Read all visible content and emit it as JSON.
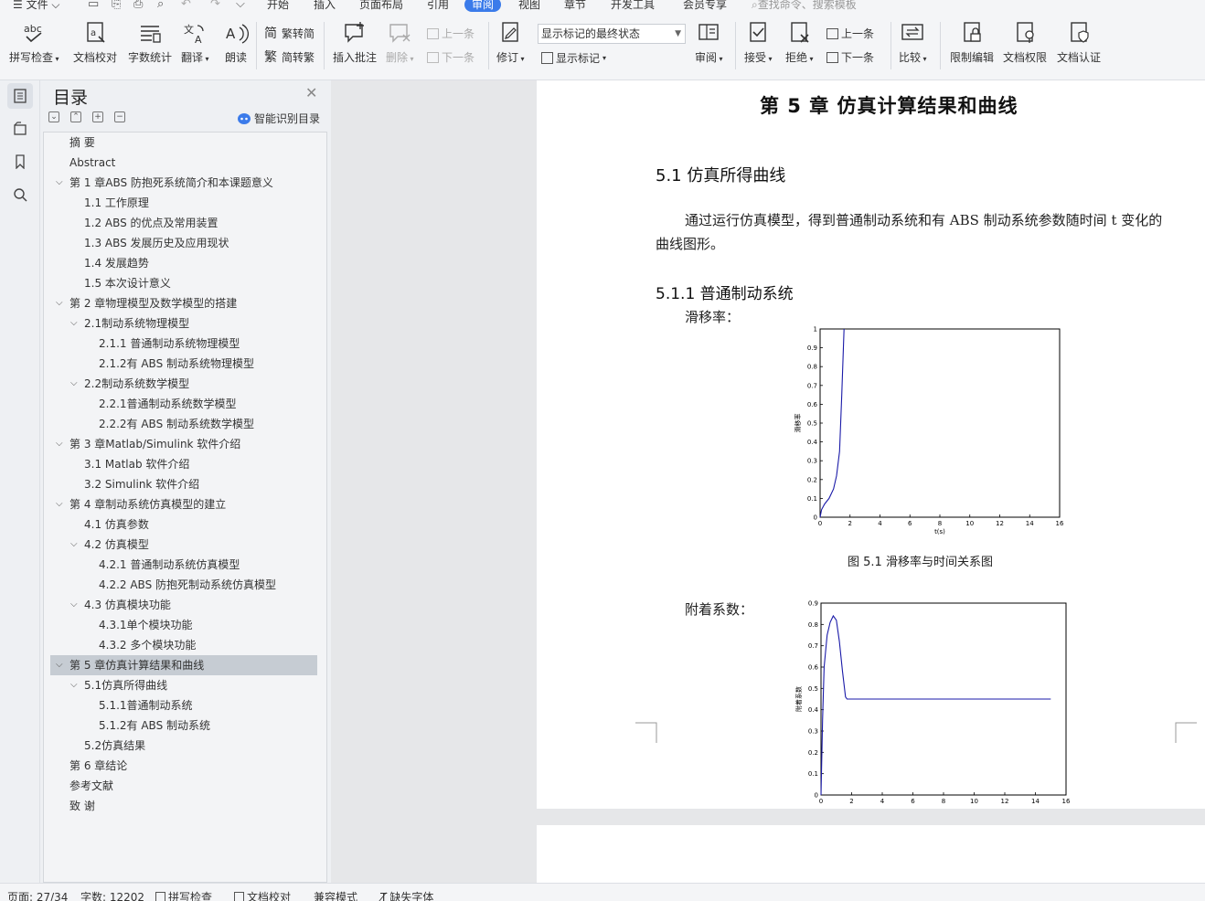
{
  "menubar": {
    "file": "文件",
    "tabs": [
      "开始",
      "插入",
      "页面布局",
      "引用",
      "审阅",
      "视图",
      "章节",
      "开发工具",
      "会员专享"
    ],
    "active_tab": "审阅",
    "search": "查找命令、搜索模板"
  },
  "ribbon": {
    "spell": "拼写检查",
    "proof": "文档校对",
    "wordcount": "字数统计",
    "translate": "翻译",
    "read": "朗读",
    "trad": "繁转简",
    "simp": "简转繁",
    "insert_comment": "插入批注",
    "delete": "删除",
    "prev": "上一条",
    "next": "下一条",
    "revise": "修订",
    "markup_state": "显示标记的最终状态",
    "show_markup": "显示标记",
    "review": "审阅",
    "accept": "接受",
    "reject": "拒绝",
    "prev2": "上一条",
    "next2": "下一条",
    "compare": "比较",
    "restrict": "限制编辑",
    "permission": "文档权限",
    "certify": "文档认证"
  },
  "toc": {
    "title": "目录",
    "smart": "智能识别目录",
    "items": [
      {
        "label": "摘  要",
        "level": 0,
        "chev": ""
      },
      {
        "label": "Abstract",
        "level": 0,
        "chev": ""
      },
      {
        "label": "第 1 章ABS 防抱死系统简介和本课题意义",
        "level": 0,
        "chev": "v"
      },
      {
        "label": "1.1  工作原理",
        "level": 1,
        "chev": ""
      },
      {
        "label": "1.2  ABS 的优点及常用装置",
        "level": 1,
        "chev": ""
      },
      {
        "label": "1.3  ABS 发展历史及应用现状",
        "level": 1,
        "chev": ""
      },
      {
        "label": "1.4  发展趋势",
        "level": 1,
        "chev": ""
      },
      {
        "label": "1.5  本次设计意义",
        "level": 1,
        "chev": ""
      },
      {
        "label": "第 2 章物理模型及数学模型的搭建",
        "level": 0,
        "chev": "v"
      },
      {
        "label": "2.1制动系统物理模型",
        "level": 1,
        "chev": "v"
      },
      {
        "label": "2.1.1  普通制动系统物理模型",
        "level": 2,
        "chev": ""
      },
      {
        "label": "2.1.2有 ABS 制动系统物理模型",
        "level": 2,
        "chev": ""
      },
      {
        "label": "2.2制动系统数学模型",
        "level": 1,
        "chev": "v"
      },
      {
        "label": "2.2.1普通制动系统数学模型",
        "level": 2,
        "chev": ""
      },
      {
        "label": "2.2.2有 ABS 制动系统数学模型",
        "level": 2,
        "chev": ""
      },
      {
        "label": "第 3 章Matlab/Simulink 软件介绍",
        "level": 0,
        "chev": "v"
      },
      {
        "label": "3.1  Matlab 软件介绍",
        "level": 1,
        "chev": ""
      },
      {
        "label": "3.2  Simulink 软件介绍",
        "level": 1,
        "chev": ""
      },
      {
        "label": "第 4 章制动系统仿真模型的建立",
        "level": 0,
        "chev": "v"
      },
      {
        "label": "4.1  仿真参数",
        "level": 1,
        "chev": ""
      },
      {
        "label": "4.2  仿真模型",
        "level": 1,
        "chev": "v"
      },
      {
        "label": "4.2.1  普通制动系统仿真模型",
        "level": 2,
        "chev": ""
      },
      {
        "label": "4.2.2  ABS 防抱死制动系统仿真模型",
        "level": 2,
        "chev": ""
      },
      {
        "label": "4.3  仿真模块功能",
        "level": 1,
        "chev": "v"
      },
      {
        "label": "4.3.1单个模块功能",
        "level": 2,
        "chev": ""
      },
      {
        "label": "4.3.2  多个模块功能",
        "level": 2,
        "chev": ""
      },
      {
        "label": "第 5 章仿真计算结果和曲线",
        "level": 0,
        "chev": "v",
        "active": true
      },
      {
        "label": "5.1仿真所得曲线",
        "level": 1,
        "chev": "v"
      },
      {
        "label": "5.1.1普通制动系统",
        "level": 2,
        "chev": ""
      },
      {
        "label": "5.1.2有 ABS 制动系统",
        "level": 2,
        "chev": ""
      },
      {
        "label": "5.2仿真结果",
        "level": 1,
        "chev": ""
      },
      {
        "label": "第 6 章结论",
        "level": 0,
        "chev": ""
      },
      {
        "label": "参考文献",
        "level": 0,
        "chev": ""
      },
      {
        "label": "致  谢",
        "level": 0,
        "chev": ""
      }
    ]
  },
  "doc": {
    "chapter_title": "第 5 章  仿真计算结果和曲线",
    "h2": "5.1  仿真所得曲线",
    "para": "通过运行仿真模型，得到普通制动系统和有 ABS 制动系统参数随时间 t 变化的曲线图形。",
    "h3": "5.1.1  普通制动系统",
    "label1": "滑移率：",
    "caption1": "图 5.1  滑移率与时间关系图",
    "label2": "附着系数："
  },
  "status": {
    "page": "页面: 27/34",
    "words": "字数: 12202",
    "spell": "拼写检查",
    "proof": "文档校对",
    "compat": "兼容模式",
    "missing_font": "缺失字体"
  },
  "chart_data": [
    {
      "type": "line",
      "title": "",
      "xlabel": "t(s)",
      "ylabel": "滑移率",
      "xlim": [
        0,
        16
      ],
      "ylim": [
        0,
        1
      ],
      "xticks": [
        0,
        2,
        4,
        6,
        8,
        10,
        12,
        14,
        16
      ],
      "yticks": [
        0,
        0.1,
        0.2,
        0.3,
        0.4,
        0.5,
        0.6,
        0.7,
        0.8,
        0.9,
        1
      ],
      "series": [
        {
          "x": [
            0,
            0.1,
            0.3,
            0.6,
            0.9,
            1.1,
            1.3,
            1.45,
            1.6
          ],
          "y": [
            0,
            0.04,
            0.07,
            0.1,
            0.15,
            0.22,
            0.35,
            0.65,
            1.0
          ],
          "color": "#1a1aa8"
        }
      ]
    },
    {
      "type": "line",
      "title": "",
      "xlabel": "",
      "ylabel": "附着系数",
      "xlim": [
        0,
        16
      ],
      "ylim": [
        0,
        0.9
      ],
      "xticks": [
        0,
        2,
        4,
        6,
        8,
        10,
        12,
        14,
        16
      ],
      "yticks": [
        0,
        0.1,
        0.2,
        0.3,
        0.4,
        0.5,
        0.6,
        0.7,
        0.8,
        0.9
      ],
      "series": [
        {
          "x": [
            0,
            0.1,
            0.2,
            0.4,
            0.6,
            0.8,
            1.0,
            1.2,
            1.4,
            1.6,
            1.7,
            15.0
          ],
          "y": [
            0,
            0.35,
            0.6,
            0.75,
            0.81,
            0.84,
            0.82,
            0.72,
            0.58,
            0.46,
            0.45,
            0.45
          ],
          "color": "#1a1aa8"
        }
      ]
    }
  ]
}
